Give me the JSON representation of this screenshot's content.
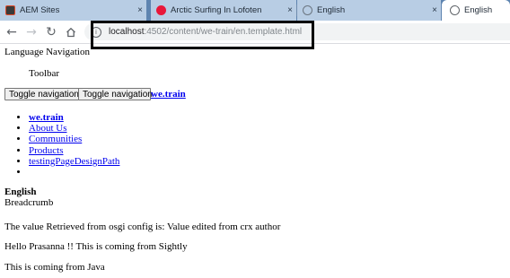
{
  "browser": {
    "tabs": [
      {
        "title": "AEM Sites",
        "icon": "aem-icon",
        "active": false
      },
      {
        "title": "Arctic Surfing In Lofoten",
        "icon": "aem-red-icon",
        "active": false
      },
      {
        "title": "English",
        "icon": "globe-icon",
        "active": false
      },
      {
        "title": "English",
        "icon": "globe-icon",
        "active": true
      }
    ],
    "close_glyph": "×",
    "address": {
      "host": "localhost",
      "path": ":4502/content/we-train/en.template.html"
    }
  },
  "page": {
    "language_navigation": "Language Navigation",
    "toolbar_label": "Toolbar",
    "toggle_buttons": [
      "Toggle navigation",
      "Toggle navigation"
    ],
    "brand_link": "we.train",
    "nav_items": [
      "we.train",
      "About Us",
      "Communities",
      "Products",
      "testingPageDesignPath",
      ""
    ],
    "current_language": "English",
    "breadcrumb": "Breadcrumb",
    "osgi_text": "The value Retrieved from osgi config is: Value edited from crx author",
    "sightly_text": "Hello Prasanna !! This is coming from Sightly",
    "java_text": "This is coming from Java"
  }
}
